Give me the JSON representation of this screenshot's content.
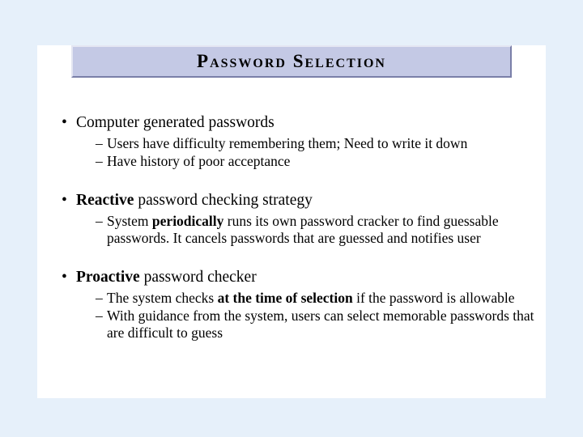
{
  "title": "Password Selection",
  "b1": {
    "head": "Computer generated passwords",
    "s1": "Users have difficulty remembering them; Need to write it down",
    "s2": "Have history of poor acceptance"
  },
  "b2": {
    "head_bold": "Reactive",
    "head_rest": " password checking strategy",
    "s1_a": "System ",
    "s1_b": "periodically",
    "s1_c": " runs its own password cracker to find guessable passwords.  It cancels passwords that are guessed and notifies user"
  },
  "b3": {
    "head_bold": "Proactive",
    "head_rest": " password checker",
    "s1_a": "The system checks ",
    "s1_b": "at the time of selection",
    "s1_c": " if the password is allowable",
    "s2": "With guidance from the system, users can select memorable passwords that are difficult to guess"
  }
}
